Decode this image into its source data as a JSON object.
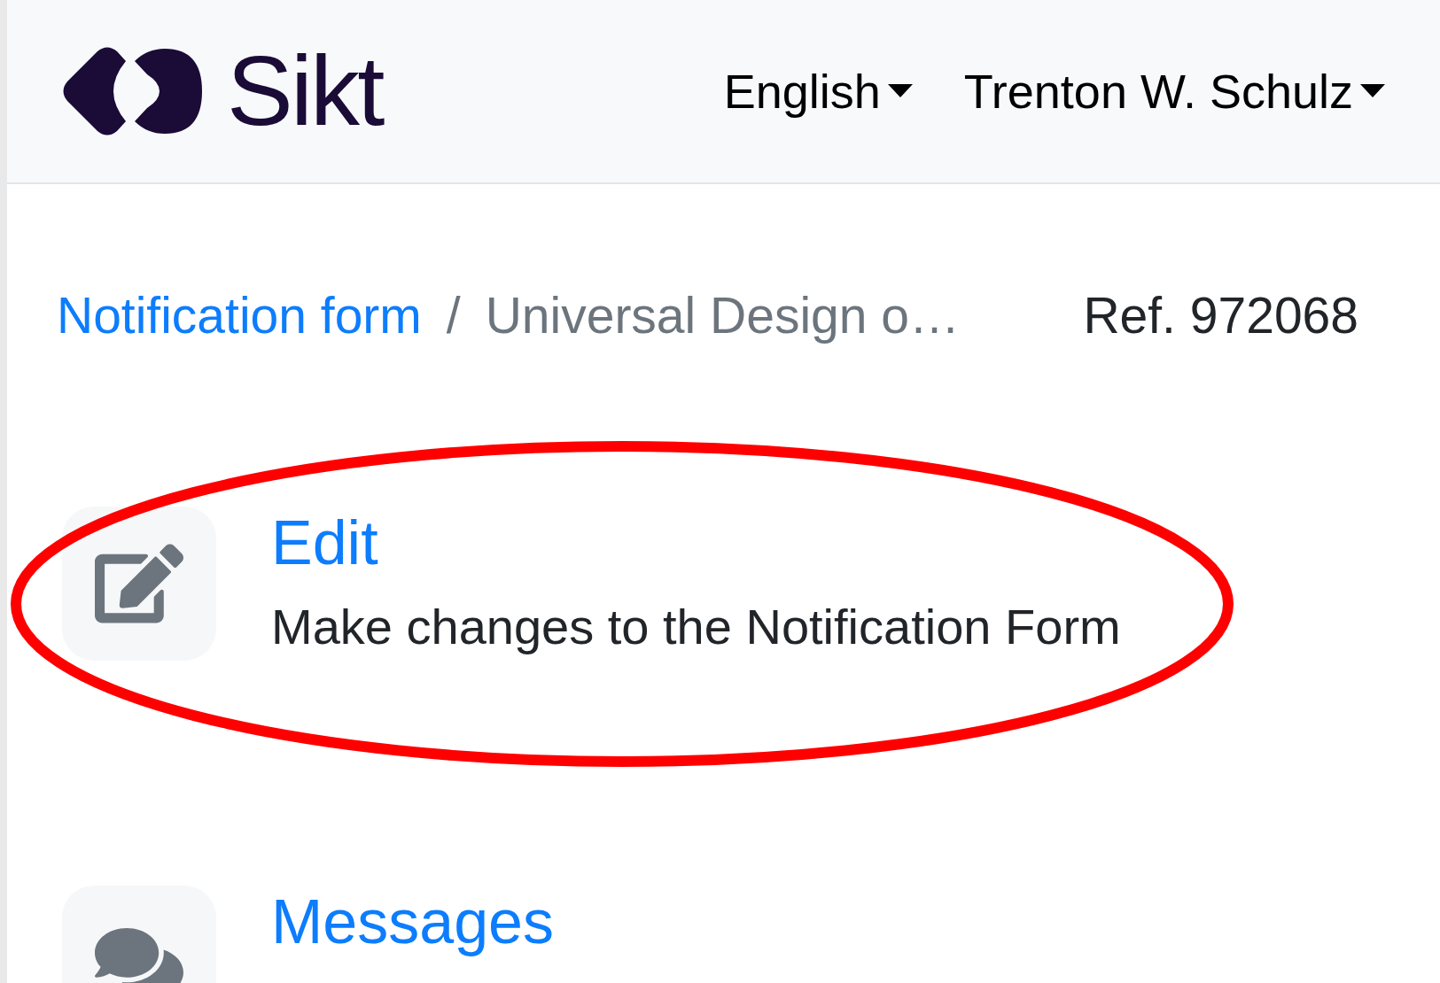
{
  "header": {
    "logo": "Sikt",
    "language": "English",
    "user": "Trenton W. Schulz"
  },
  "breadcrumb": [
    {
      "label": "Notification form",
      "kind": "link"
    },
    {
      "label": "Universal Design o…",
      "kind": "current"
    }
  ],
  "separator": "/",
  "reference": "Ref. 972068",
  "actions": [
    {
      "kind": "edit",
      "title": "Edit",
      "description": "Make changes to the Notification Form",
      "highlighted": true
    },
    {
      "kind": "messages",
      "title": "Messages",
      "highlighted": false
    }
  ]
}
